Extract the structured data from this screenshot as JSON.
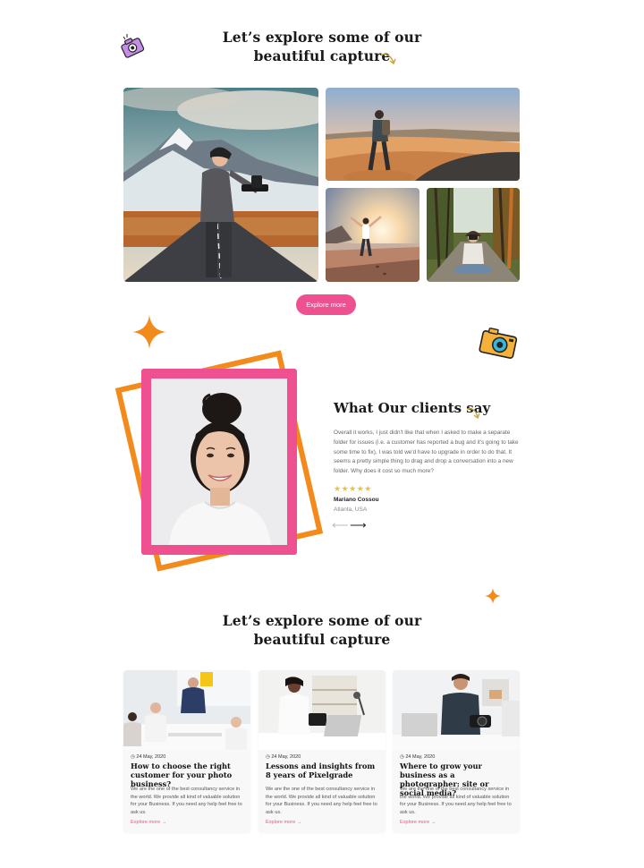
{
  "gallery": {
    "heading_line1": "Let’s explore  some of our",
    "heading_line2": "beautiful capture",
    "explore_button": "Explore more"
  },
  "testimonial": {
    "heading": "What Our clients say",
    "quote": "Overall it works, I just didn't like that when I asked to make a separate folder for issues (i.e. a customer has reported a bug and it's going to take some time to fix), I was told we'd have to upgrade in order to do that. It seems a pretty simple thing to drag and drop a conversation into a new folder. Why does it cost so much more?",
    "rating": 5,
    "stars": "★★★★★",
    "author": "Mariano Cossou",
    "location": "Atlanta, USA",
    "prev_arrow": "⟵",
    "next_arrow": "⟶"
  },
  "blog": {
    "heading_line1": "Let’s explore  some of our",
    "heading_line2": "beautiful capture",
    "posts": [
      {
        "date": "24 May, 2020",
        "title": "How to choose the right customer for your photo business?",
        "excerpt": "We are the one of the best consultancy service in the world. We provide all kind of valuable solution for your Business. If you need any help feel free to ask us.",
        "link": "Explore more →"
      },
      {
        "date": "24 May, 2020",
        "title": "Lessons and insights from 8 years of Pixelgrade",
        "excerpt": "We are the one of the best consultancy service in the world. We provide all kind of valuable solution for your Business. If you need any help feel free to ask us.",
        "link": "Explore more →"
      },
      {
        "date": "24 May, 2020",
        "title": "Where to grow your business as a photographer: site or social media?",
        "excerpt": "We are the one of the best consultancy service in the world. We provide all kind of valuable solution for your Business. If you need any help feel free to ask us.",
        "link": "Explore more →"
      }
    ]
  },
  "colors": {
    "accent_pink": "#ef5190",
    "accent_orange": "#f28a1c",
    "star_yellow": "#f3c12b"
  }
}
